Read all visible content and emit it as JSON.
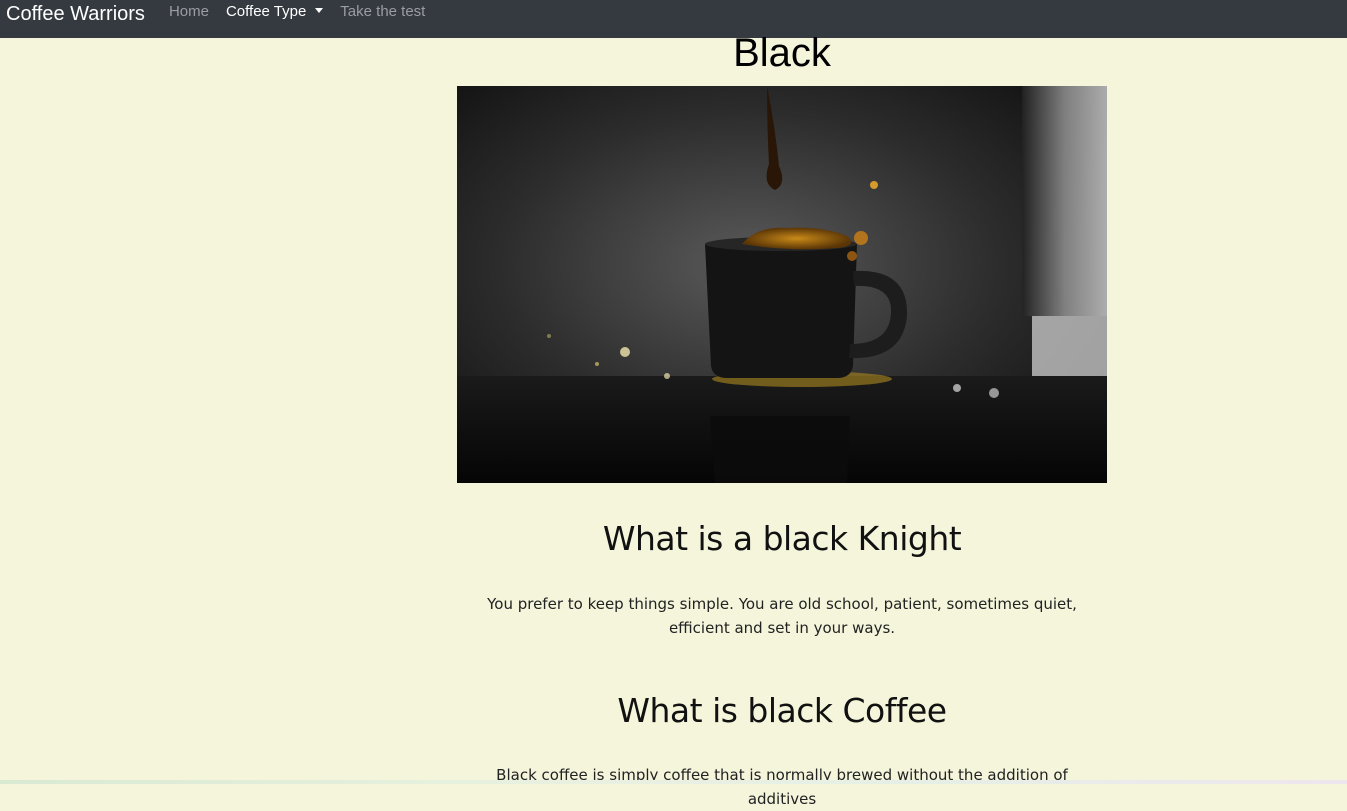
{
  "navbar": {
    "brand": "Coffee Warriors",
    "links": [
      {
        "label": "Home"
      },
      {
        "label": "Coffee Type"
      },
      {
        "label": "Take the test"
      }
    ]
  },
  "page": {
    "title": "Black"
  },
  "sections": [
    {
      "heading": "What is a black Knight",
      "text": "You prefer to keep things simple. You are old school, patient, sometimes quiet, efficient and set in your ways."
    },
    {
      "heading": "What is black Coffee",
      "text": "Black coffee is simply coffee that is normally brewed without the addition of additives"
    }
  ],
  "colors": {
    "navbar_bg": "#343a40",
    "page_bg": "#f5f5dc",
    "nav_link": "#9a9da1",
    "nav_active": "#ffffff"
  },
  "icons": {
    "dropdown": "caret-down-icon"
  }
}
